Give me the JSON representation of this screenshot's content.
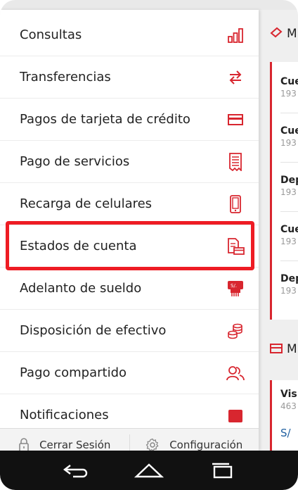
{
  "menu": {
    "items": [
      {
        "label": "Consultas",
        "icon": "bar-chart-icon"
      },
      {
        "label": "Transferencias",
        "icon": "transfer-arrows-icon"
      },
      {
        "label": "Pagos de tarjeta de crédito",
        "icon": "credit-card-icon"
      },
      {
        "label": "Pago de servicios",
        "icon": "receipt-icon"
      },
      {
        "label": "Recarga de celulares",
        "icon": "mobile-phone-icon"
      },
      {
        "label": "Estados de cuenta",
        "icon": "account-statement-icon"
      },
      {
        "label": "Adelanto de sueldo",
        "icon": "salary-advance-icon"
      },
      {
        "label": "Disposición de efectivo",
        "icon": "coins-icon"
      },
      {
        "label": "Pago compartido",
        "icon": "users-icon"
      },
      {
        "label": "Notificaciones",
        "icon": "notification-icon"
      }
    ],
    "highlighted": "Estados de cuenta"
  },
  "bottom": {
    "logout_label": "Cerrar Sesión",
    "settings_label": "Configuración"
  },
  "background": {
    "section1_label": "M",
    "section2_label": "M",
    "accounts": [
      {
        "name": "Cue",
        "number": "193"
      },
      {
        "name": "Cue",
        "number": "193"
      },
      {
        "name": "Dep",
        "number": "193"
      },
      {
        "name": "Cue",
        "number": "193"
      },
      {
        "name": "Dep",
        "number": "193"
      }
    ],
    "card": {
      "name": "Vis",
      "number": "463",
      "amount": "S/"
    }
  },
  "colors": {
    "accent": "#d8262f",
    "highlight": "#ee1c24",
    "nav_bar": "#111111"
  }
}
